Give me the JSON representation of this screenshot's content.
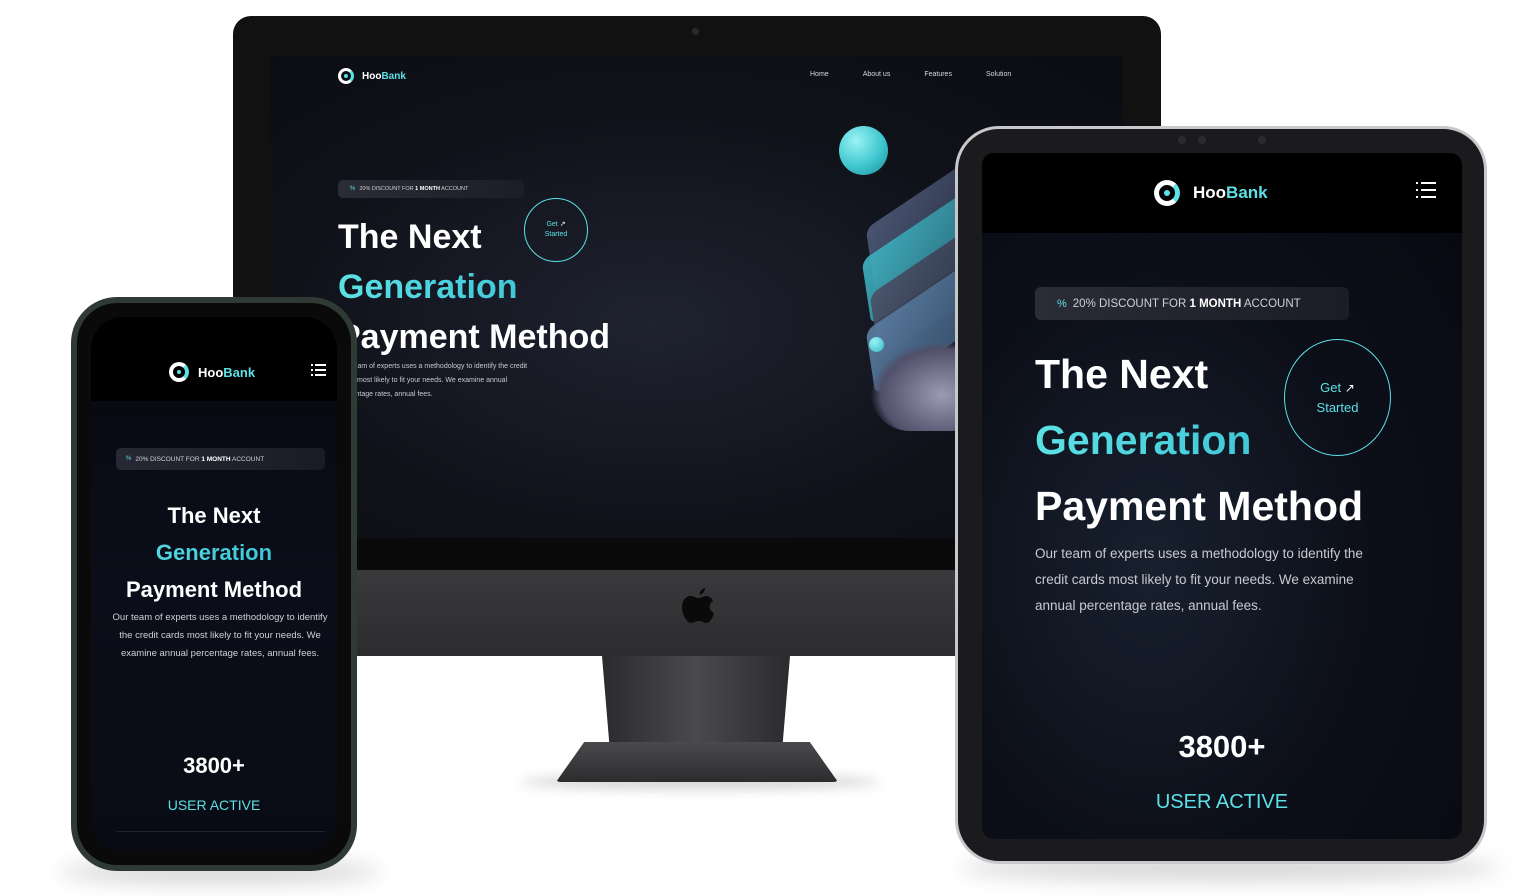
{
  "brand": {
    "name_part1": "Hoo",
    "name_part2": "Bank"
  },
  "desktop": {
    "nav": [
      "Home",
      "About us",
      "Features",
      "Solution"
    ],
    "badge": {
      "percent_icon": "%",
      "prefix": "20% DISCOUNT FOR ",
      "highlight": "1 MONTH",
      "suffix": " ACCOUNT"
    },
    "heading": {
      "line1": "The Next",
      "line2": "Generation",
      "line3": "Payment Method"
    },
    "paragraph": "Our team of experts uses a methodology to identify the credit cards most likely to fit your needs. We examine annual percentage rates, annual fees.",
    "get_started": {
      "line1": "Get",
      "arrow": "↗",
      "line2": "Started"
    }
  },
  "phone": {
    "badge": {
      "percent_icon": "%",
      "prefix": "20% DISCOUNT FOR ",
      "highlight": "1 MONTH",
      "suffix": " ACCOUNT"
    },
    "heading": {
      "line1": "The Next",
      "line2": "Generation",
      "line3": "Payment Method"
    },
    "paragraph": "Our team of experts uses a methodology to identify the credit cards most likely to fit your needs. We examine annual percentage rates, annual fees.",
    "stat_value": "3800+",
    "stat_label": "USER ACTIVE"
  },
  "tablet": {
    "badge": {
      "percent_icon": "%",
      "prefix": "20% DISCOUNT FOR ",
      "highlight": "1 MONTH",
      "suffix": " ACCOUNT"
    },
    "heading": {
      "line1": "The Next",
      "line2": "Generation",
      "line3": "Payment Method"
    },
    "paragraph": "Our team of experts uses a methodology to identify the credit cards most likely to fit your needs. We examine annual percentage rates, annual fees.",
    "get_started": {
      "line1": "Get",
      "arrow": "↗",
      "line2": "Started"
    },
    "stat_value": "3800+",
    "stat_label": "USER ACTIVE"
  },
  "colors": {
    "accent": "#5ce1e6",
    "background": "#0b0c12"
  },
  "icons": [
    "hoobank-logo-icon",
    "menu-icon",
    "apple-logo-icon",
    "percent-icon",
    "arrow-up-right-icon"
  ]
}
